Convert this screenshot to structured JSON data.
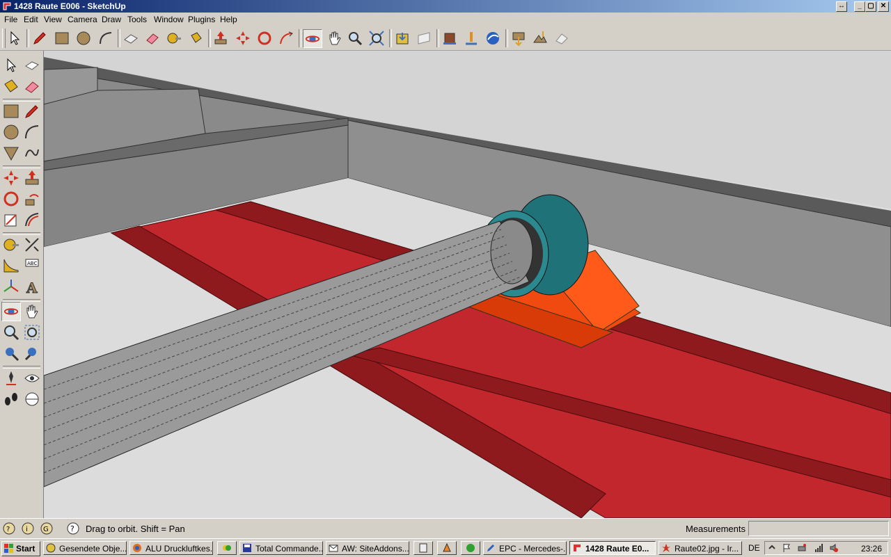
{
  "window": {
    "title": "1428 Raute E006 - SketchUp",
    "controls": [
      "restore-icon",
      "minimize-icon",
      "maximize-icon",
      "close-icon"
    ]
  },
  "menu": [
    "File",
    "Edit",
    "View",
    "Camera",
    "Draw",
    "Tools",
    "Window",
    "Plugins",
    "Help"
  ],
  "toolbar": {
    "icons": [
      "select-icon",
      "pencil-icon",
      "rectangle-icon",
      "circle-icon",
      "arc-icon",
      "eraser-shape-icon",
      "eraser-icon",
      "tape-measure-icon",
      "paint-bucket-icon",
      "push-pull-icon",
      "move-icon",
      "rotate-icon",
      "follow-me-icon",
      "orbit-icon",
      "pan-icon",
      "zoom-icon",
      "zoom-extents-icon",
      "get-models-icon",
      "share-model-icon",
      "components-icon",
      "place-model-icon",
      "google-earth-icon",
      "get-current-view-icon",
      "toggle-terrain-icon",
      "preview-in-earth-icon"
    ],
    "active": "orbit-icon"
  },
  "left_toolbar": {
    "icons": [
      "select-icon",
      "make-component-icon",
      "paint-bucket-icon",
      "eraser-icon",
      "rectangle-icon",
      "line-icon",
      "circle-icon",
      "arc-icon",
      "polygon-icon",
      "freehand-icon",
      "move-icon",
      "push-pull-icon",
      "rotate-icon",
      "follow-me-icon",
      "scale-icon",
      "offset-icon",
      "tape-measure-icon",
      "dimension-icon",
      "protractor-icon",
      "text-icon",
      "axes-icon",
      "3d-text-icon",
      "orbit-icon",
      "pan-icon",
      "zoom-icon",
      "zoom-window-icon",
      "zoom-extents-icon",
      "previous-view-icon",
      "position-camera-icon",
      "look-around-icon",
      "walk-icon",
      "section-plane-icon"
    ],
    "active": "orbit-icon"
  },
  "colors": {
    "beam": "#8a8a8a",
    "floor": "#dcdcdc",
    "rail_red": "#c1272d",
    "rail_dark": "#8e1a1e",
    "bracket_orange": "#f04a10",
    "collar_teal": "#1f7277",
    "pipe_gray": "#9a9a9a"
  },
  "status": {
    "text": "Drag to orbit.  Shift = Pan",
    "measurements_label": "Measurements",
    "measurements_value": ""
  },
  "taskbar": {
    "start": "Start",
    "items": [
      {
        "label": "Gesendete Obje...",
        "icon": "outlook-icon",
        "active": false
      },
      {
        "label": "ALU Druckluftkes...",
        "icon": "firefox-icon",
        "active": false
      },
      {
        "label": "",
        "icon": "msn-icon",
        "active": false
      },
      {
        "label": "Total Commande...",
        "icon": "save-disk-icon",
        "active": false
      },
      {
        "label": "AW: SiteAddons...",
        "icon": "mail-icon",
        "active": false
      },
      {
        "label": "",
        "icon": "calculator-icon",
        "active": false
      },
      {
        "label": "",
        "icon": "vlc-icon",
        "active": false
      },
      {
        "label": "",
        "icon": "green-app-icon",
        "active": false
      },
      {
        "label": "EPC - Mercedes-...",
        "icon": "pen-icon",
        "active": false
      },
      {
        "label": "1428 Raute E0...",
        "icon": "sketchup-icon",
        "active": true
      },
      {
        "label": "Raute02.jpg - Ir...",
        "icon": "irfanview-icon",
        "active": false
      }
    ],
    "language": "DE",
    "clock": "23:26",
    "tray_icons": [
      "chevron-up-icon",
      "flag-icon",
      "printer-icon",
      "network-icon",
      "volume-muted-icon"
    ]
  }
}
